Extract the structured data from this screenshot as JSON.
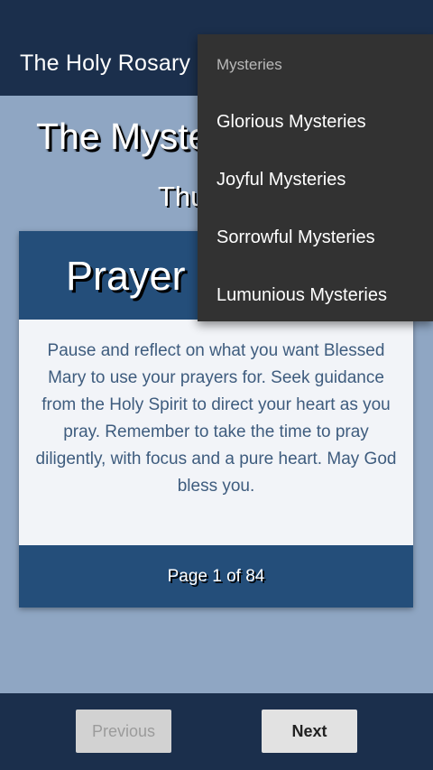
{
  "app": {
    "title": "The Holy Rosary"
  },
  "page": {
    "title": "The Mysteries",
    "subtitle": "Thursday"
  },
  "card": {
    "header": "Prayer",
    "body": "Pause and reflect on what you want Blessed Mary to use your prayers for. Seek guidance from the Holy Spirit to direct your heart as you pray. Remember to take the time to pray diligently, with focus and a pure heart. May God bless you.",
    "page_indicator": "Page 1 of 84"
  },
  "navigation": {
    "previous_label": "Previous",
    "next_label": "Next",
    "previous_enabled": false
  },
  "menu": {
    "header": "Mysteries",
    "items": [
      {
        "label": "Glorious Mysteries"
      },
      {
        "label": "Joyful Mysteries"
      },
      {
        "label": "Sorrowful Mysteries"
      },
      {
        "label": "Lumunious Mysteries"
      }
    ]
  },
  "colors": {
    "appbar": "#1b2f4c",
    "background": "#8fa6c3",
    "card_accent": "#244e7a",
    "menu_bg": "#323232"
  }
}
